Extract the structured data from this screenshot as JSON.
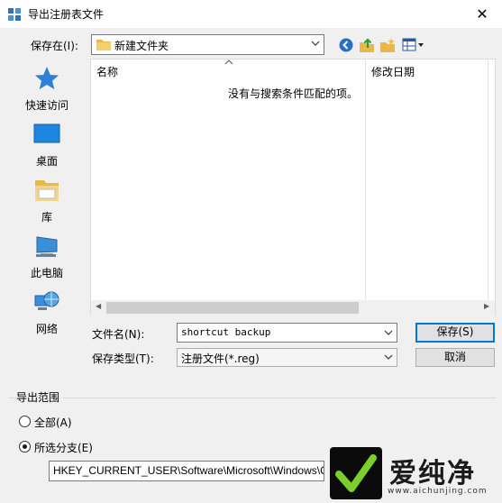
{
  "window": {
    "title": "导出注册表文件",
    "close_glyph": "✕"
  },
  "toolbar": {
    "save_in_label": "保存在(I):",
    "location": "新建文件夹",
    "icons": [
      "back-icon",
      "up-folder-icon",
      "new-folder-icon",
      "view-menu-icon"
    ]
  },
  "places": [
    {
      "label": "快速访问",
      "icon": "star-icon"
    },
    {
      "label": "桌面",
      "icon": "desktop-icon"
    },
    {
      "label": "库",
      "icon": "library-icon"
    },
    {
      "label": "此电脑",
      "icon": "computer-icon"
    },
    {
      "label": "网络",
      "icon": "network-icon"
    }
  ],
  "file_list": {
    "columns": [
      "名称",
      "修改日期"
    ],
    "empty_message": "没有与搜索条件匹配的项。"
  },
  "form": {
    "file_name_label": "文件名(N):",
    "file_name_value": "shortcut backup",
    "file_type_label": "保存类型(T):",
    "file_type_value": "注册文件(*.reg)",
    "save_button": "保存(S)",
    "cancel_button": "取消"
  },
  "export_range": {
    "title": "导出范围",
    "option_all": "全部(A)",
    "option_selected": "所选分支(E)",
    "selected": "option_selected",
    "branch_path": "HKEY_CURRENT_USER\\Software\\Microsoft\\Windows\\CurrentVersion\\Explorer"
  },
  "watermark": {
    "text": "爱纯净",
    "url": "www.aichunjing.com"
  },
  "colors": {
    "accent": "#0078d7",
    "window_bg": "#f0f0f0",
    "folder": "#e8b84a"
  }
}
